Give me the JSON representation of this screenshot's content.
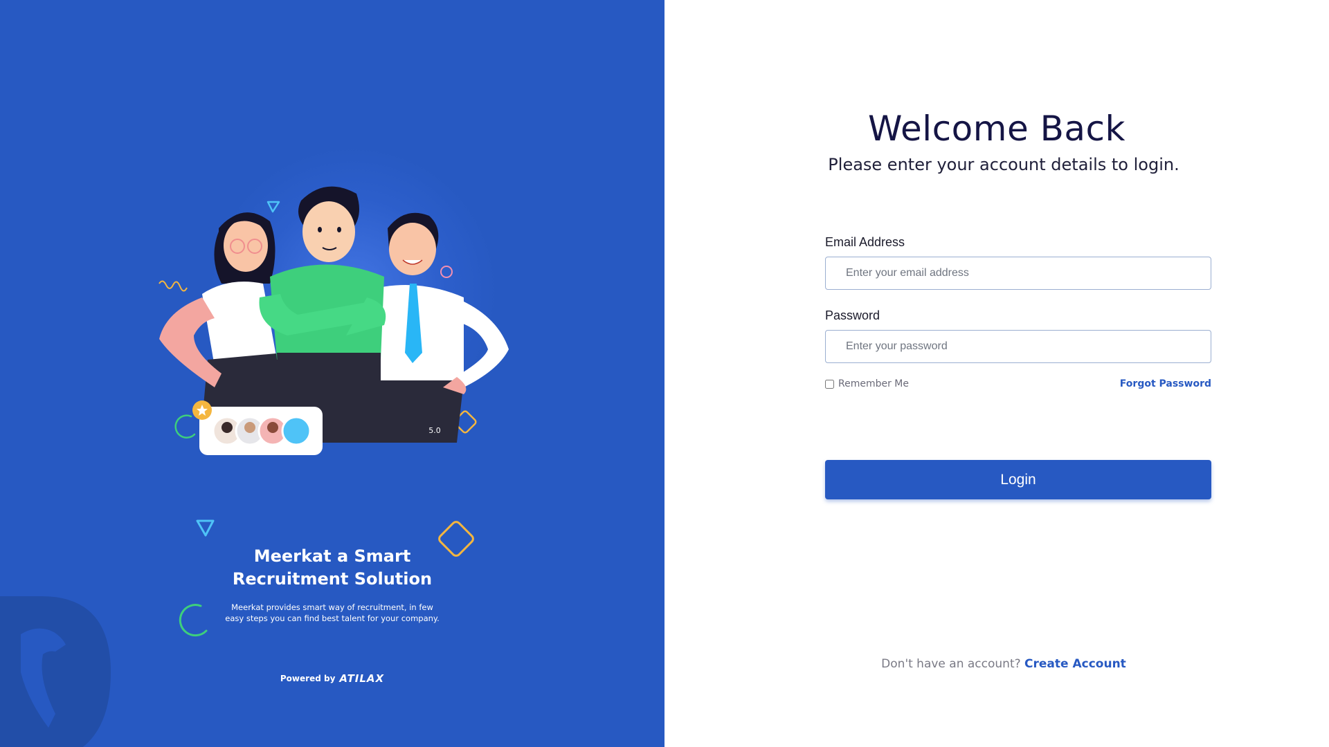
{
  "branding": {
    "tagline_title_line1": "Meerkat a Smart",
    "tagline_title_line2": "Recruitment Solution",
    "tagline_description": "Meerkat provides smart way of recruitment, in few easy steps you can find best talent for your company.",
    "powered_by_label": "Powered by",
    "powered_by_brand": "ATILAX",
    "rating_value": "5.0",
    "primary_color": "#2759c2"
  },
  "login": {
    "title": "Welcome Back",
    "subtitle": "Please enter your account details to login.",
    "email_label": "Email Address",
    "email_placeholder": "Enter your email address",
    "email_value": "",
    "password_label": "Password",
    "password_placeholder": "Enter your password",
    "password_value": "",
    "remember_label": "Remember Me",
    "remember_checked": false,
    "forgot_label": "Forgot Password",
    "submit_label": "Login",
    "signup_prompt": "Don't have an account?",
    "signup_link": "Create Account"
  },
  "icons": {
    "brand_mark": "meerkat-logo-icon",
    "star": "star-icon"
  }
}
